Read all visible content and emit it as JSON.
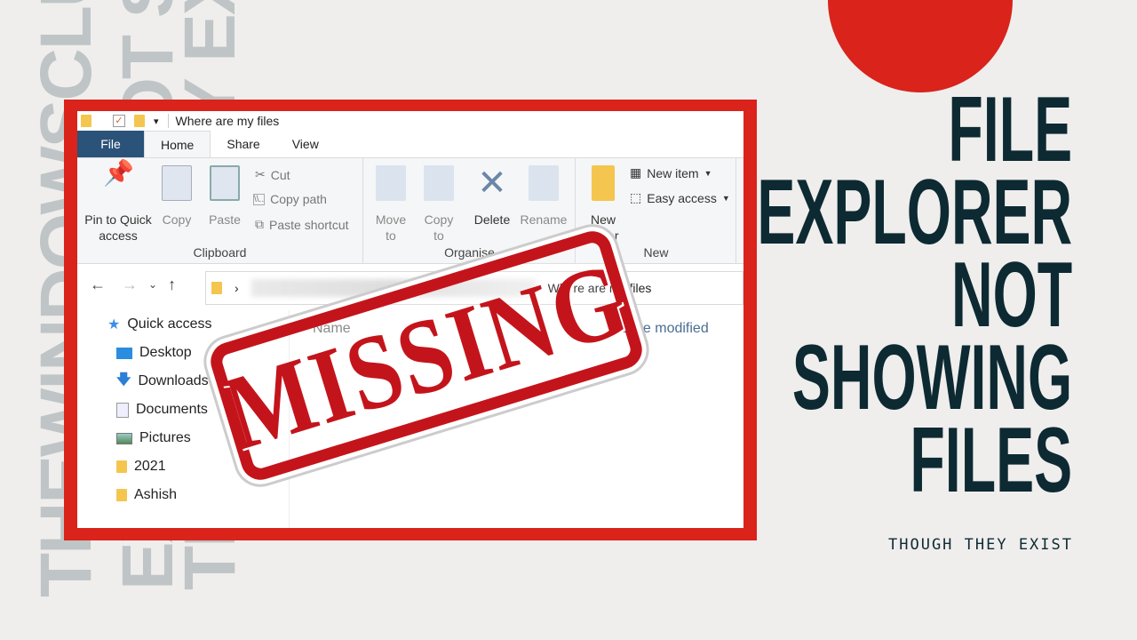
{
  "watermark": {
    "line1": "THEWINDOWSCLUB.COM",
    "line2": "EXPLORER NOT SHOWING FILES",
    "line3": "THOUGH THEY EXIST"
  },
  "headline": {
    "lines": [
      "FILE",
      "EXPLORER",
      "NOT",
      "SHOWING",
      "FILES"
    ],
    "subtitle": "THOUGH THEY EXIST"
  },
  "colors": {
    "accent": "#d9231b",
    "title": "#0d2a33",
    "file_tab": "#2b5278"
  },
  "explorer": {
    "window_title": "Where are my files",
    "tabs": [
      "File",
      "Home",
      "Share",
      "View"
    ],
    "clipboard": {
      "pin": "Pin to Quick access",
      "copy": "Copy",
      "paste": "Paste",
      "cut": "Cut",
      "copy_path": "Copy path",
      "paste_shortcut": "Paste shortcut",
      "label": "Clipboard"
    },
    "organise": {
      "move_to": "Move to",
      "copy_to": "Copy to",
      "delete": "Delete",
      "rename": "Rename",
      "label": "Organise"
    },
    "new": {
      "new_folder": "New folder",
      "new_item": "New item",
      "easy_access": "Easy access",
      "label": "New"
    },
    "address": {
      "current": "Where are my files"
    },
    "columns": {
      "name": "Name",
      "date_modified": "Date modified"
    },
    "sidebar": [
      {
        "label": "Quick access",
        "icon": "star-icon"
      },
      {
        "label": "Desktop",
        "icon": "desktop-icon"
      },
      {
        "label": "Downloads",
        "icon": "download-icon"
      },
      {
        "label": "Documents",
        "icon": "documents-icon"
      },
      {
        "label": "Pictures",
        "icon": "pictures-icon"
      },
      {
        "label": "2021",
        "icon": "folder-icon"
      },
      {
        "label": "Ashish",
        "icon": "folder-icon"
      }
    ]
  },
  "stamp": {
    "text": "MISSING"
  }
}
